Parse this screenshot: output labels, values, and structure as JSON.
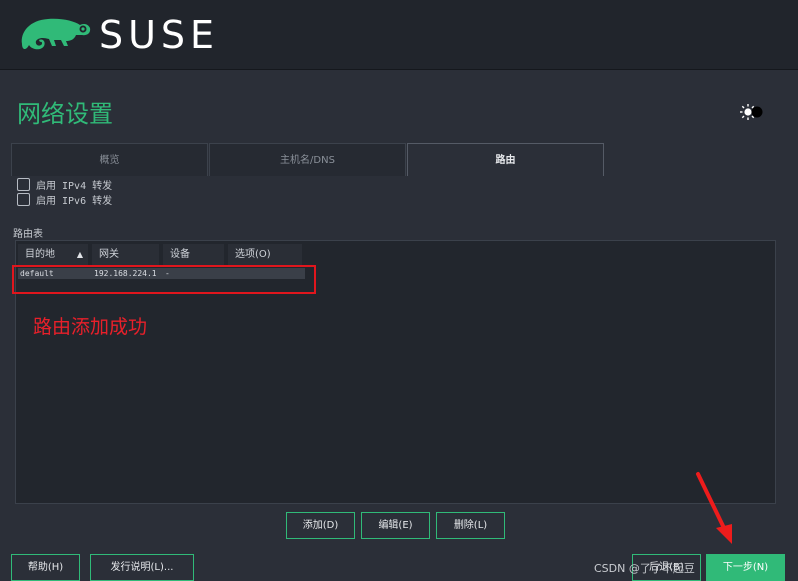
{
  "header": {
    "brand": "SUSE",
    "logo_icon": "chameleon-icon"
  },
  "page": {
    "title": "网络设置",
    "theme_toggle_icon": "sun-moon-icon"
  },
  "tabs": [
    {
      "label": "概览",
      "active": false
    },
    {
      "label": "主机名/DNS",
      "active": false
    },
    {
      "label": "路由",
      "active": true
    }
  ],
  "options": {
    "ipv4_forward": {
      "label": "启用 IPv4 转发",
      "checked": false
    },
    "ipv6_forward": {
      "label": "启用 IPv6 转发",
      "checked": false
    }
  },
  "routing_table": {
    "label": "路由表",
    "columns": [
      "目的地",
      "网关",
      "设备",
      "选项(O)"
    ],
    "sort_icon": "sort-ascending-icon",
    "rows": [
      {
        "destination": "default",
        "gateway": "192.168.224.1",
        "device": "-",
        "options": ""
      }
    ]
  },
  "annotation": {
    "text": "路由添加成功",
    "color": "#e8202a"
  },
  "actions": {
    "add": "添加(D)",
    "edit": "编辑(E)",
    "delete": "删除(L)"
  },
  "footer": {
    "help": "帮助(H)",
    "release_notes": "发行说明(L)...",
    "back": "后退(B)",
    "next": "下一步(N)"
  },
  "watermark": "CSDN @了了不起豆",
  "colors": {
    "accent": "#30ba78",
    "background": "#2b2f38",
    "header": "#21252c",
    "highlight": "#e0161d"
  }
}
